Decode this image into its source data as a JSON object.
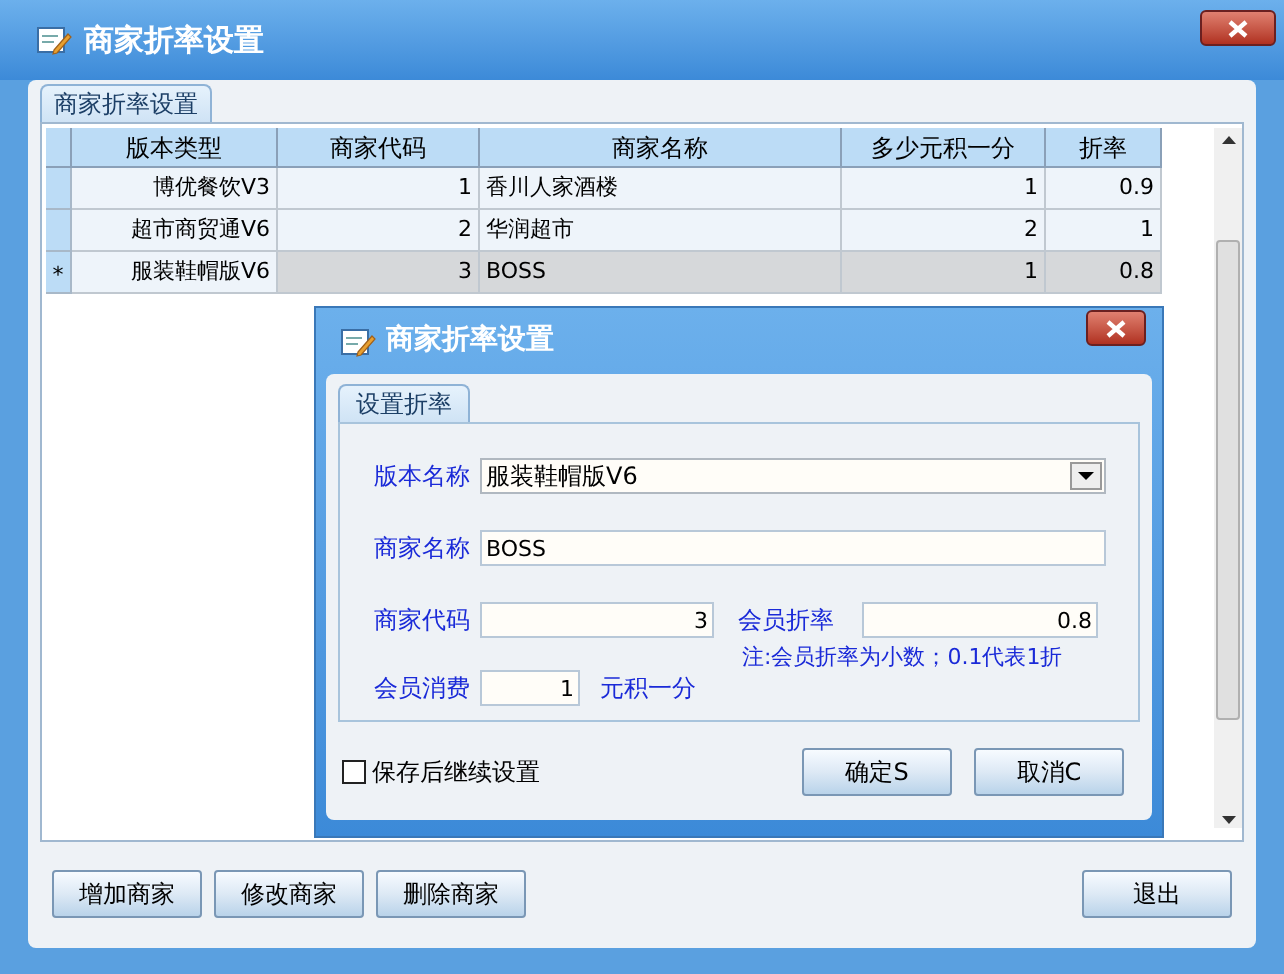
{
  "window": {
    "title": "商家折率设置"
  },
  "tabs": [
    {
      "label": "商家折率设置",
      "selected": true
    }
  ],
  "table": {
    "columns": [
      "版本类型",
      "商家代码",
      "商家名称",
      "多少元积一分",
      "折率"
    ],
    "rows": [
      {
        "marker": "",
        "selected": false,
        "cells": [
          "博优餐饮V3",
          "1",
          "香川人家酒楼",
          "1",
          "0.9"
        ]
      },
      {
        "marker": "",
        "selected": false,
        "cells": [
          "超市商贸通V6",
          "2",
          "华润超市",
          "2",
          "1"
        ]
      },
      {
        "marker": "*",
        "selected": true,
        "cells": [
          "服装鞋帽版V6",
          "3",
          "BOSS",
          "1",
          "0.8"
        ]
      }
    ]
  },
  "buttons_left": [
    "增加商家",
    "修改商家",
    "删除商家"
  ],
  "buttons_right": [
    "退出"
  ],
  "dialog": {
    "title": "商家折率设置",
    "tabs": [
      {
        "label": "设置折率",
        "selected": true
      }
    ],
    "version": {
      "label": "版本名称",
      "value": "服装鞋帽版V6"
    },
    "merchant_name": {
      "label": "商家名称",
      "value": "BOSS"
    },
    "merchant_code": {
      "label": "商家代码",
      "value": "3"
    },
    "rate": {
      "label": "会员折率",
      "value": "0.8"
    },
    "note": "注:会员折率为小数；0.1代表1折",
    "consumption": {
      "label": "会员消费",
      "value": "1",
      "suffix": "元积一分"
    },
    "continue_checkbox": {
      "label": "保存后继续设置",
      "checked": false
    },
    "buttons": [
      "确定S",
      "取消C"
    ]
  }
}
